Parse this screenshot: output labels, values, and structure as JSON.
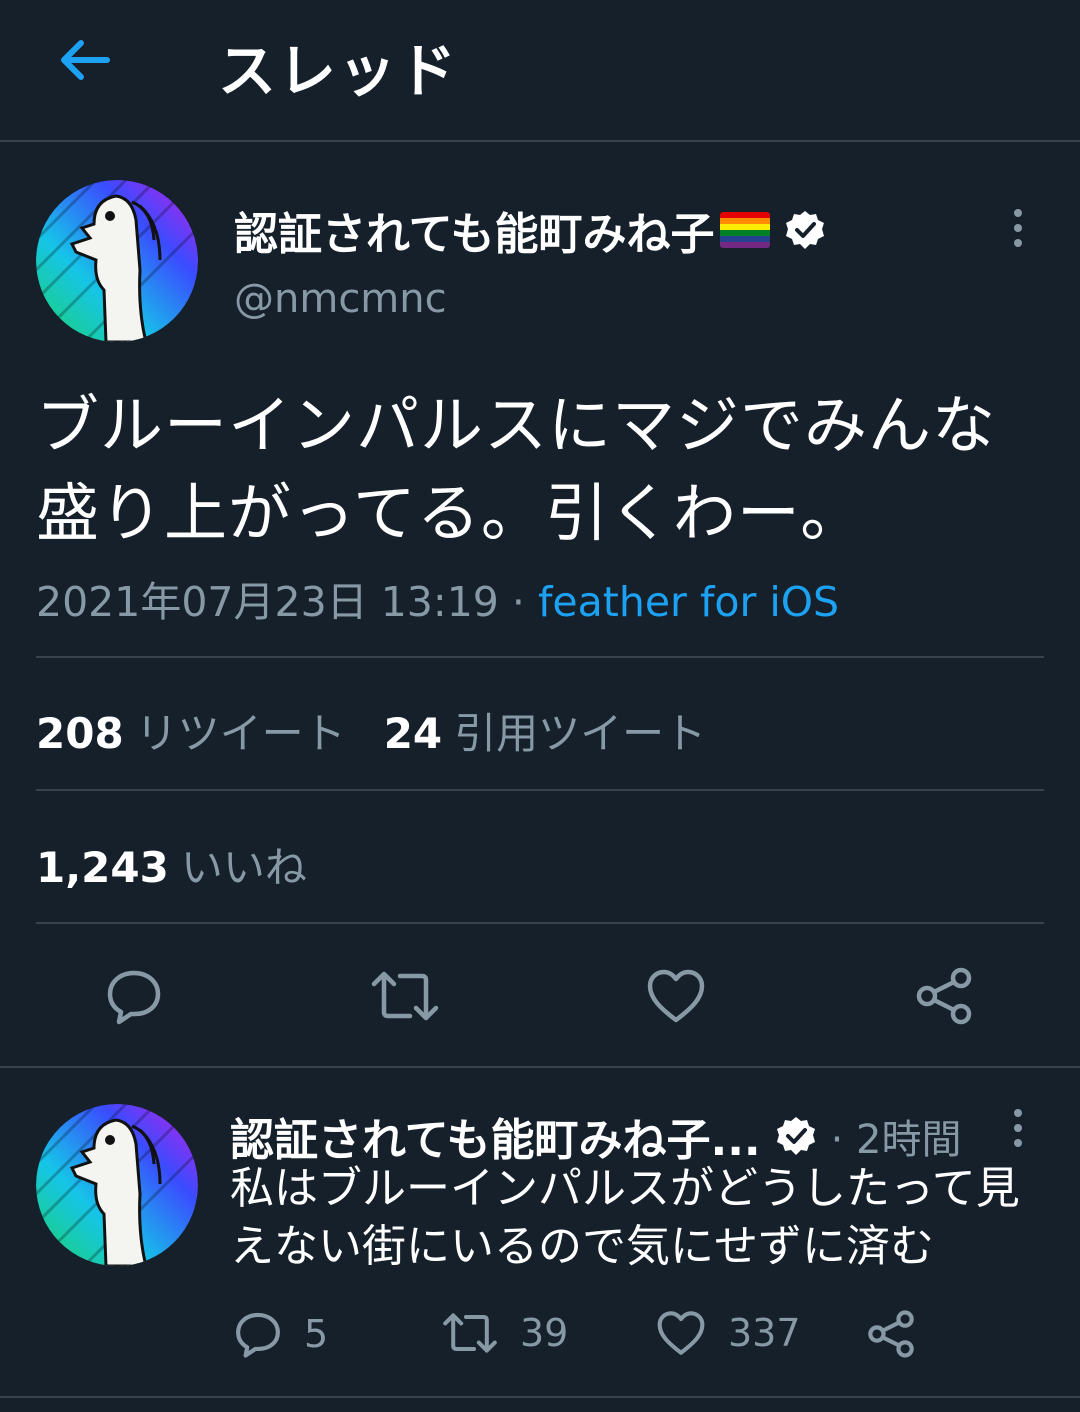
{
  "header": {
    "title": "スレッド",
    "back_icon": "arrow-left-icon"
  },
  "tweet": {
    "display_name": "認証されても能町みね子",
    "handle": "@nmcmnc",
    "text_line1": "ブルーインパルスにマジでみんな",
    "text_line2": "盛り上がってる。引くわー。",
    "timestamp": "2021年07月23日 13:19",
    "separator": " · ",
    "source": "feather for iOS",
    "retweets": {
      "count": "208",
      "label": "リツイート"
    },
    "quotes": {
      "count": "24",
      "label": "引用ツイート"
    },
    "likes": {
      "count": "1,243",
      "label": "いいね"
    }
  },
  "reply": {
    "display_name": "認証されても能町みね子...",
    "time": "· 2時間",
    "text": "私はブルーインパルスがどうしたって見えない街にいるので気にせずに済む",
    "replies": "5",
    "retweets": "39",
    "likes": "337"
  },
  "colors": {
    "background": "#15202b",
    "divider": "#38444d",
    "secondary_text": "#8899a6",
    "accent": "#1da1f2"
  }
}
